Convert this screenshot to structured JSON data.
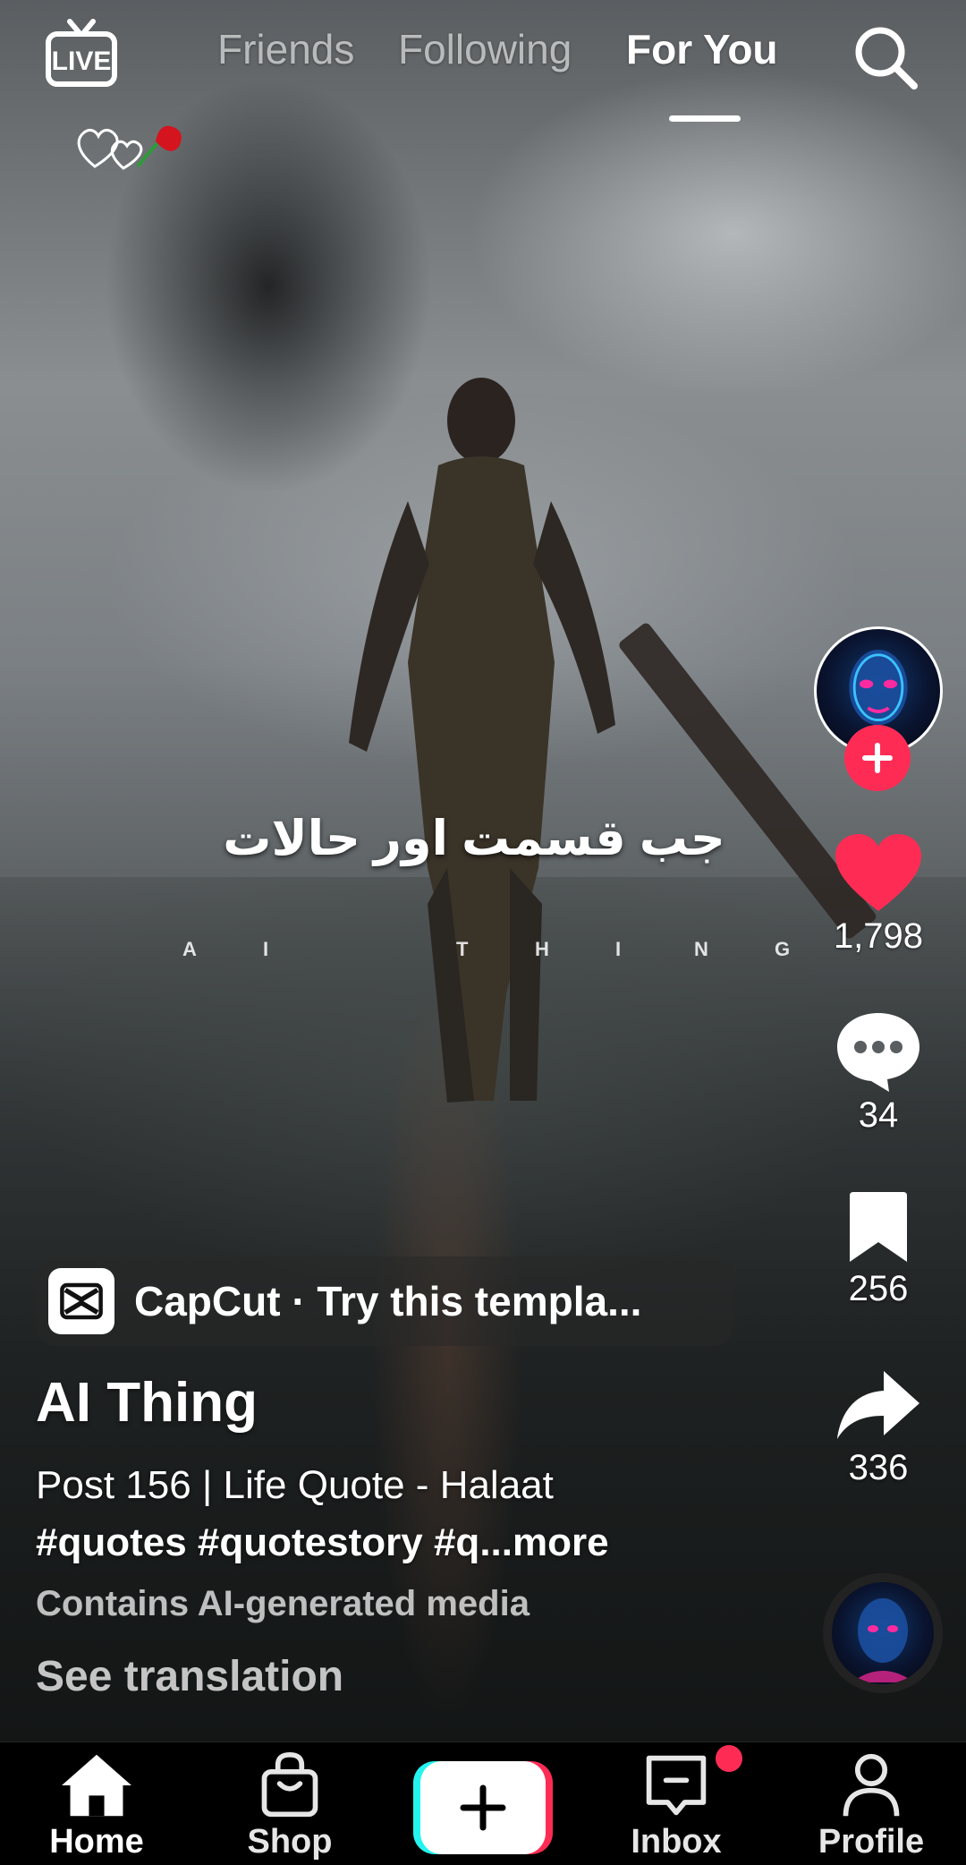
{
  "top_nav": {
    "live_label": "LIVE",
    "tabs": [
      {
        "label": "Friends"
      },
      {
        "label": "Following"
      },
      {
        "label": "For You"
      }
    ]
  },
  "video": {
    "overlay_urdu": "جب قسمت اور حالات",
    "overlay_letters": [
      "A",
      "I",
      "T",
      "H",
      "I",
      "N",
      "G"
    ]
  },
  "actions": {
    "likes": "1,798",
    "comments": "34",
    "saves": "256",
    "shares": "336"
  },
  "post": {
    "template_text": "CapCut · Try this templa...",
    "author": "AI Thing",
    "caption": "Post 156 | Life Quote - Halaat",
    "hashtags": "#quotes #quotestory #q",
    "more": "...more",
    "ai_label": "Contains AI-generated media",
    "see_translation": "See translation"
  },
  "bottom_nav": {
    "home": "Home",
    "shop": "Shop",
    "inbox": "Inbox",
    "profile": "Profile"
  },
  "colors": {
    "accent": "#fe2c55",
    "create_left": "#25f4ee",
    "create_right": "#fe2c55"
  }
}
